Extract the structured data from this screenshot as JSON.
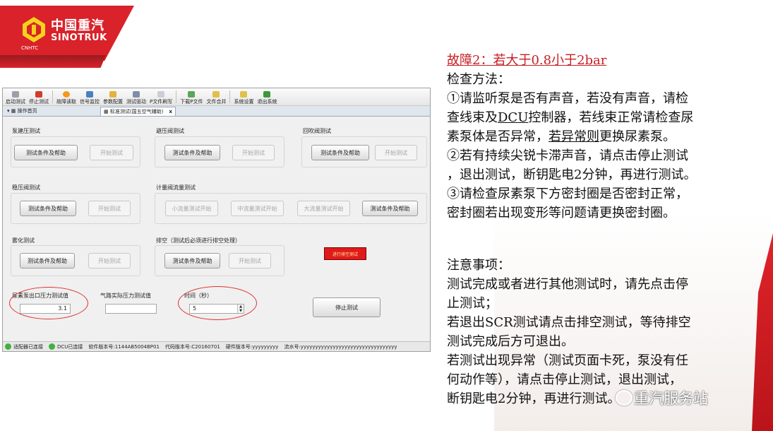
{
  "logo": {
    "cn": "中国重汽",
    "en": "SINOTRUK",
    "small": "CNHTC"
  },
  "toolbar": [
    "启动测试",
    "停止测试",
    "故障读取",
    "信号监控",
    "参数配置",
    "测试驱动",
    "P文件刷写",
    "下载P文件",
    "文件合并",
    "系统设置",
    "退出系统"
  ],
  "tabs": {
    "home": "操作首页",
    "active": "标准测试(国五空气辅助)",
    "close": "x"
  },
  "groups": {
    "pump": {
      "title": "泵建压测试",
      "help": "测试条件及帮助",
      "start": "开始测试"
    },
    "avoid": {
      "title": "避压阀测试",
      "help": "测试条件及帮助",
      "start": "开始测试"
    },
    "reflux": {
      "title": "回吹阀测试",
      "help": "测试条件及帮助",
      "start": "开始测试"
    },
    "stable": {
      "title": "稳压阀测试",
      "help": "测试条件及帮助",
      "start": "开始测试"
    },
    "meter": {
      "title": "计量阀流量测试",
      "small": "小流量测试开始",
      "mid": "中流量测试开始",
      "large": "大流量测试开始",
      "help": "测试条件及帮助"
    },
    "atom": {
      "title": "雾化测试",
      "help": "测试条件及帮助",
      "start": "开始测试"
    },
    "drain": {
      "title": "排空（测试后必须进行排空处理）",
      "help": "测试条件及帮助",
      "start": "开始测试"
    }
  },
  "red_button": "进行排空测试",
  "readouts": {
    "outlet_label": "尿素泵出口压力测试值",
    "outlet_value": "3.1",
    "air_label": "气路实际压力测试值",
    "air_value": "",
    "time_label": "时间（秒）",
    "time_value": "5"
  },
  "stop_button": "停止测试",
  "status": {
    "adapter": "适配器已连接",
    "dcu": "DCU已连接",
    "software": "软件版本号:1144AB5004BP01",
    "code": "代码版本号:C20160701",
    "hardware": "硬件版本号:yyyyyyyyy",
    "serial": "流水号:yyyyyyyyyyyyyyyyyyyyyyyyyyyyyyyyy"
  },
  "right": {
    "title": "故障2：若大于0.8小于2bar",
    "method": "检查方法：",
    "p1a": "①请监听泵是否有声音，若没有声音，请检",
    "p1b_pre": "查线束及",
    "p1b_u": "DCU",
    "p1b_post": "控制器，若线束正常请检查尿",
    "p1c_pre": "素泵体是否异常，",
    "p1c_u": "若异常则",
    "p1c_post": "更换尿素泵。",
    "p2a": "②若有持续尖锐卡滞声音，请点击停止测试",
    "p2b": "，退出测试，断钥匙电2分钟，再进行测试。",
    "p3a": "③请检查尿素泵下方密封圈是否密封正常，",
    "p3b": "密封圈若出现变形等问题请更换密封圈。",
    "note": "注意事项：",
    "n1a": "测试完成或者进行其他测试时，请先点击停",
    "n1b": "止测试；",
    "n2a": "若退出SCR测试请点击排空测试，等待排空",
    "n2b": "测试完成后方可退出。",
    "n3a": "若测试出现异常（测试页面卡死，泵没有任",
    "n3b": "何动作等），请点击停止测试，退出测试，",
    "n3c": "断钥匙电2分钟，再进行测试。"
  },
  "watermark": "重汽服务站",
  "colors": {
    "brand": "#d9222a",
    "title_red": "#c81e24",
    "status_green": "#3fb23f"
  }
}
